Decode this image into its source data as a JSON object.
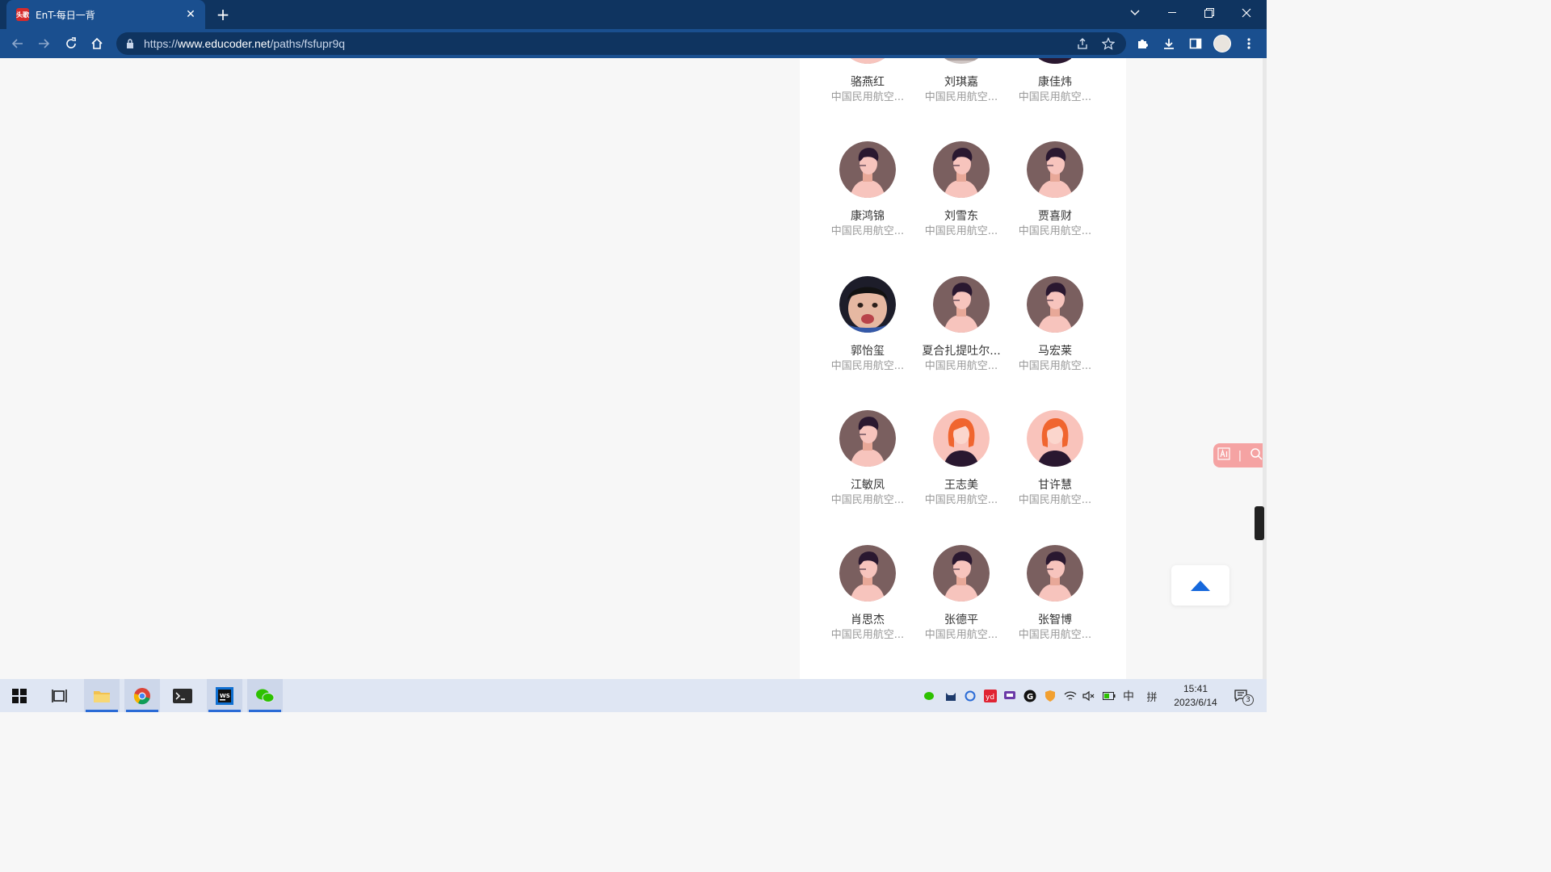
{
  "browser": {
    "tab_title": "EnT-每日一背",
    "favicon_text": "头歌",
    "url_prefix": "https://",
    "url_domain": "www.educoder.net",
    "url_path": "/paths/fsfupr9q"
  },
  "members": [
    {
      "name": "骆燕红",
      "school": "中国民用航空...",
      "avatar": "male"
    },
    {
      "name": "刘琪嘉",
      "school": "中国民用航空...",
      "avatar": "photo-gray"
    },
    {
      "name": "康佳炜",
      "school": "中国民用航空...",
      "avatar": "female"
    },
    {
      "name": "康鸿锦",
      "school": "中国民用航空...",
      "avatar": "male"
    },
    {
      "name": "刘雪东",
      "school": "中国民用航空...",
      "avatar": "male"
    },
    {
      "name": "贾喜财",
      "school": "中国民用航空...",
      "avatar": "male"
    },
    {
      "name": "郭怡玺",
      "school": "中国民用航空...",
      "avatar": "photo-child"
    },
    {
      "name": "夏合扎提吐尔...",
      "school": "中国民用航空...",
      "avatar": "male"
    },
    {
      "name": "马宏莱",
      "school": "中国民用航空...",
      "avatar": "male"
    },
    {
      "name": "江敏凤",
      "school": "中国民用航空...",
      "avatar": "male"
    },
    {
      "name": "王志美",
      "school": "中国民用航空...",
      "avatar": "female"
    },
    {
      "name": "甘许慧",
      "school": "中国民用航空...",
      "avatar": "female"
    },
    {
      "name": "肖思杰",
      "school": "中国民用航空...",
      "avatar": "male"
    },
    {
      "name": "张德平",
      "school": "中国民用航空...",
      "avatar": "male"
    },
    {
      "name": "张智博",
      "school": "中国民用航空...",
      "avatar": "male"
    }
  ],
  "taskbar": {
    "time": "15:41",
    "date": "2023/6/14",
    "ime_lang": "中",
    "ime_mode": "拼",
    "notification_count": "3"
  },
  "colors": {
    "titlebar": "#0f3460",
    "toolbar": "#1a4f8f",
    "accent_blue": "#1668dc",
    "side_tool_pink": "#f5a3a3"
  }
}
